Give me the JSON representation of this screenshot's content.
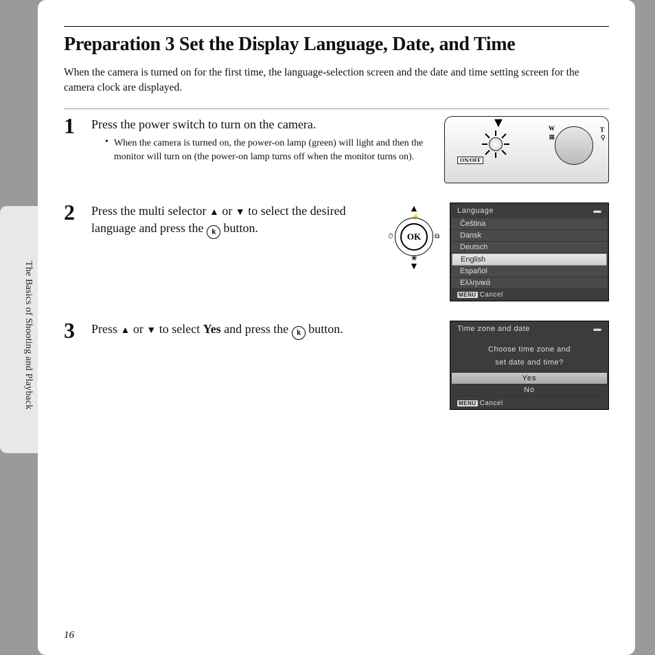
{
  "sideText": "The Basics of Shooting and Playback",
  "title": "Preparation 3 Set the Display Language, Date, and Time",
  "intro": "When the camera is turned on for the first time, the language-selection screen and the date and time setting screen for the camera clock are displayed.",
  "steps": {
    "s1": {
      "num": "1",
      "head": "Press the power switch to turn on the camera.",
      "bullet": "When the camera is turned on, the power-on lamp (green) will light and then the monitor will turn on (the power-on lamp turns off when the monitor turns on)."
    },
    "s2": {
      "num": "2",
      "head_a": "Press the multi selector ",
      "head_b": " or ",
      "head_c": " to select the desired language and press the ",
      "head_d": " button."
    },
    "s3": {
      "num": "3",
      "head_a": "Press ",
      "head_b": " or ",
      "head_c": " to select ",
      "head_yes": "Yes",
      "head_d": " and press the ",
      "head_e": " button."
    }
  },
  "camera": {
    "onoff": "ON/OFF",
    "w": "W",
    "t": "T",
    "grid": "▦",
    "mag": "⚲"
  },
  "okLabel": "OK",
  "okInline": "k",
  "langScreen": {
    "title": "Language",
    "items": [
      "Čeština",
      "Dansk",
      "Deutsch",
      "English",
      "Español",
      "Ελληνικά"
    ],
    "selectedIndex": 3,
    "cancel": "Cancel",
    "menu": "MENU"
  },
  "tzScreen": {
    "title": "Time zone and date",
    "line1": "Choose time zone and",
    "line2": "set date and time?",
    "yes": "Yes",
    "no": "No",
    "cancel": "Cancel",
    "menu": "MENU"
  },
  "pageNumber": "16"
}
